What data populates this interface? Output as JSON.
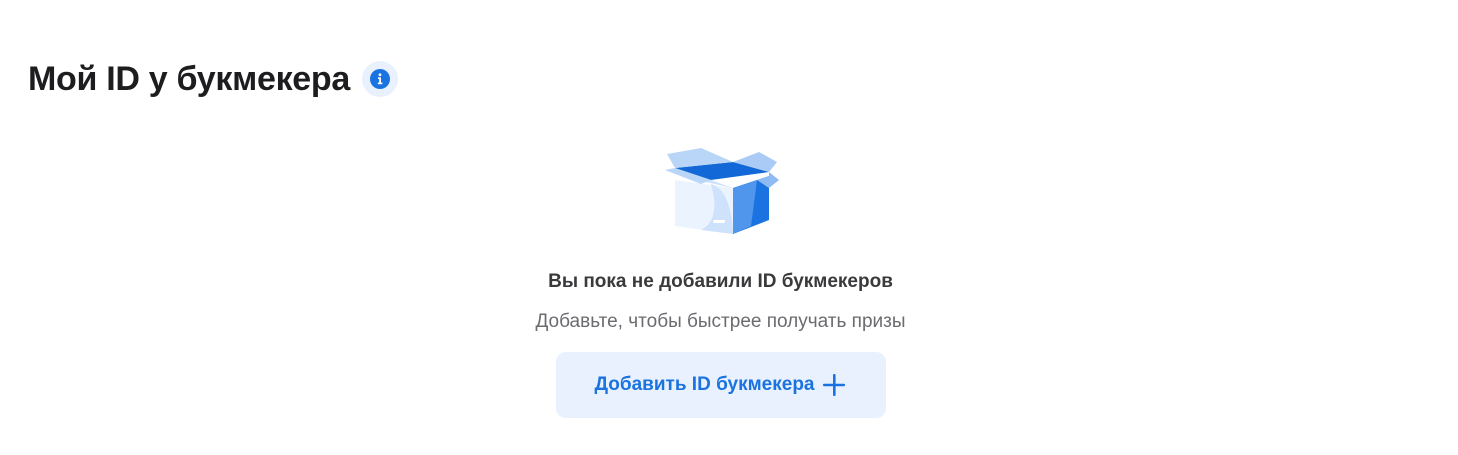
{
  "header": {
    "title": "Мой ID у букмекера",
    "info_icon": "info-icon"
  },
  "empty_state": {
    "illustration": "open-box-illustration",
    "title": "Вы пока не добавили ID букмекеров",
    "subtitle": "Добавьте, чтобы быстрее получать призы",
    "add_button_label": "Добавить ID букмекера",
    "add_button_icon": "plus-icon"
  },
  "colors": {
    "accent": "#1a73e0",
    "button_background": "#e8f1fd",
    "title_text": "#1d1d1f",
    "subtitle_text": "#6b6b70"
  }
}
